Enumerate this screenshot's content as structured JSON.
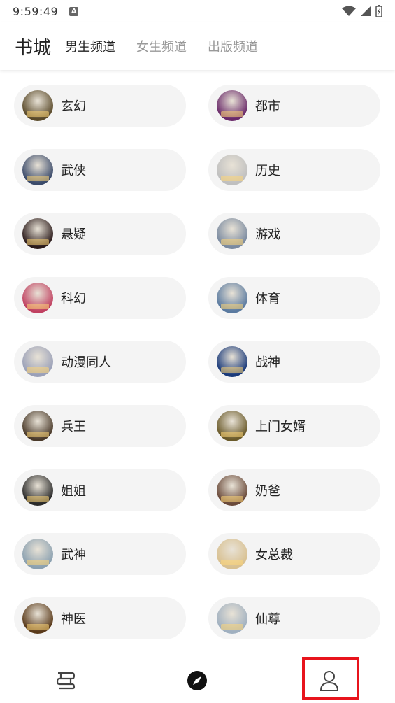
{
  "status_bar": {
    "time": "9:59:49",
    "notification_letter": "A"
  },
  "header": {
    "title": "书城",
    "tabs": [
      {
        "label": "男生频道",
        "active": true
      },
      {
        "label": "女生频道",
        "active": false
      },
      {
        "label": "出版频道",
        "active": false
      }
    ]
  },
  "categories": [
    {
      "label": "玄幻"
    },
    {
      "label": "都市"
    },
    {
      "label": "武侠"
    },
    {
      "label": "历史"
    },
    {
      "label": "悬疑"
    },
    {
      "label": "游戏"
    },
    {
      "label": "科幻"
    },
    {
      "label": "体育"
    },
    {
      "label": "动漫同人"
    },
    {
      "label": "战神"
    },
    {
      "label": "兵王"
    },
    {
      "label": "上门女婿"
    },
    {
      "label": "姐姐"
    },
    {
      "label": "奶爸"
    },
    {
      "label": "武神"
    },
    {
      "label": "女总裁"
    },
    {
      "label": "神医"
    },
    {
      "label": "仙尊"
    }
  ],
  "cover_colors": [
    "#5a4a2a",
    "#6a2a6a",
    "#3a4a6a",
    "#bfbfbf",
    "#2a1a1a",
    "#7a8aa0",
    "#c04060",
    "#5a7aa0",
    "#9aa0b8",
    "#1a3a7a",
    "#4a3a2a",
    "#6a5a2a",
    "#2a2a2a",
    "#6a4a3a",
    "#8aa0b0",
    "#d8c090",
    "#5a3a1a",
    "#a0b0c0"
  ],
  "bottom_nav": {
    "items": [
      {
        "icon": "bookshelf-icon"
      },
      {
        "icon": "compass-icon"
      },
      {
        "icon": "profile-icon"
      }
    ]
  },
  "highlight_color": "#e8141c"
}
